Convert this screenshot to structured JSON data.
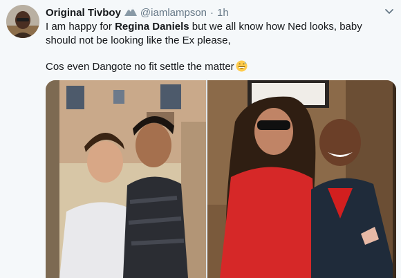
{
  "tweet": {
    "display_name": "Original Tivboy",
    "handle": "@iamlampson",
    "separator": "·",
    "time": "1h",
    "text_before_mention": "I am happy for ",
    "mention": "Regina Daniels",
    "text_after_mention": " but we all know how Ned looks, baby should not be looking like the Ex please,",
    "second_line": "Cos even Dangote no fit settle the matter",
    "name_emoji": "mountain-snow-icon",
    "text_emoji": "grinning-sweat-icon"
  },
  "media": {
    "photo_count": 2
  },
  "colors": {
    "page_bg": "#f5f8fa",
    "text": "#14171a",
    "secondary": "#657786"
  }
}
